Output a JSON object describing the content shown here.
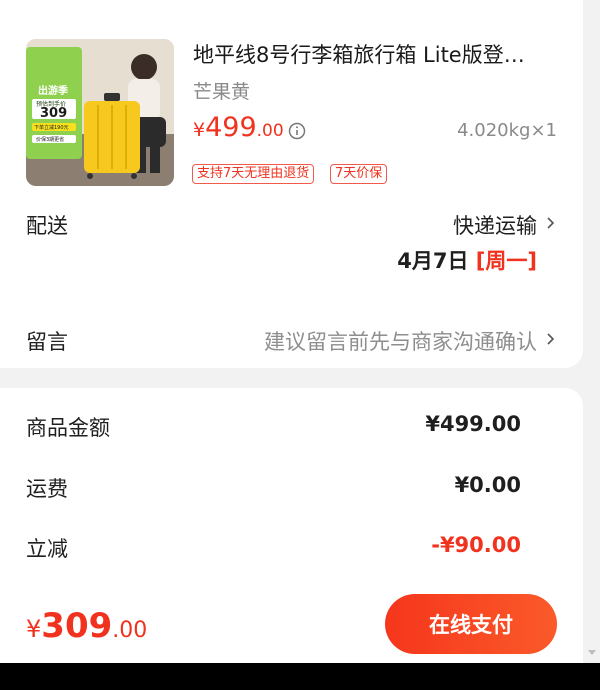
{
  "product": {
    "title": "地平线8号行李箱旅行箱 Lite版登…",
    "variant": "芒果黄",
    "price_currency": "¥",
    "price_int": "499",
    "price_dec": ".00",
    "weight_qty": "4.020kg×1",
    "tags": [
      "支持7天无理由退货",
      "7天价保"
    ],
    "thumb_badge": {
      "brand": "出游季",
      "price": "309",
      "line1": "预估到手价",
      "line2": "下单立减190元",
      "line3": "价保3期更省"
    }
  },
  "delivery": {
    "label": "配送",
    "method": "快递运输",
    "date": "4月7日",
    "weekday": "[周一]"
  },
  "message": {
    "label": "留言",
    "placeholder": "建议留言前先与商家沟通确认"
  },
  "summary": {
    "rows": [
      {
        "label": "商品金额",
        "value": "¥499.00"
      },
      {
        "label": "运费",
        "value": "¥0.00"
      },
      {
        "label": "立减",
        "value": "-¥90.00"
      }
    ]
  },
  "footer": {
    "total_currency": "¥",
    "total_int": "309",
    "total_dec": ".00",
    "pay_label": "在线支付"
  },
  "colors": {
    "accent": "#f0321e",
    "muted": "#8a8a8a",
    "background": "#f2f2f2"
  }
}
